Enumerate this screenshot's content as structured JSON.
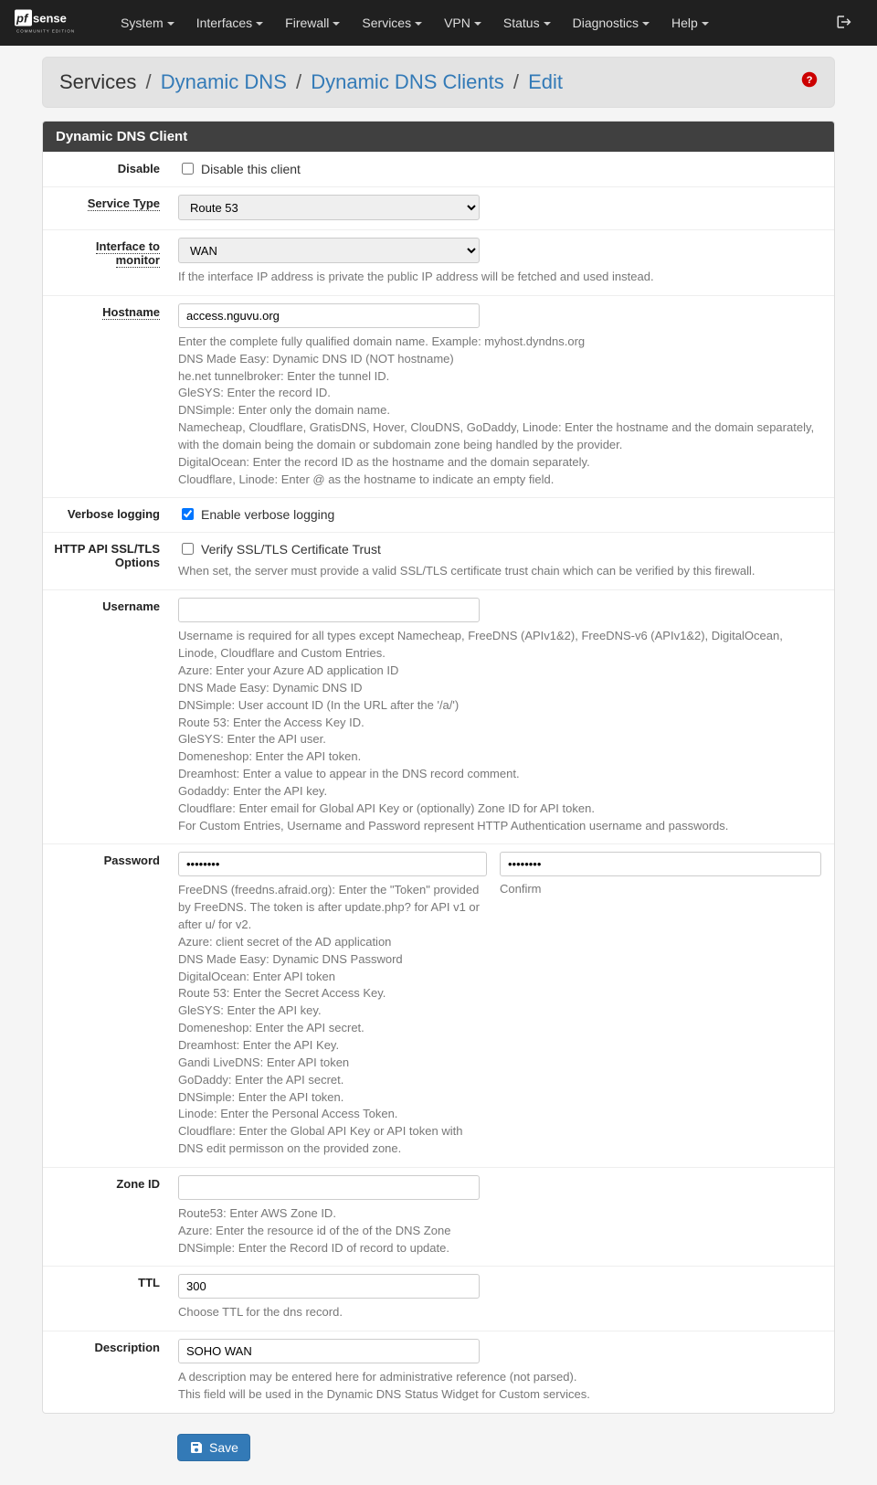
{
  "nav": {
    "items": [
      "System",
      "Interfaces",
      "Firewall",
      "Services",
      "VPN",
      "Status",
      "Diagnostics",
      "Help"
    ]
  },
  "breadcrumb": {
    "a": "Services",
    "b": "Dynamic DNS",
    "c": "Dynamic DNS Clients",
    "d": "Edit"
  },
  "panel_title": "Dynamic DNS Client",
  "labels": {
    "disable": "Disable",
    "service_type": "Service Type",
    "interface": "Interface to monitor",
    "hostname": "Hostname",
    "verbose": "Verbose logging",
    "ssl": "HTTP API SSL/TLS Options",
    "username": "Username",
    "password": "Password",
    "zone": "Zone ID",
    "ttl": "TTL",
    "description": "Description"
  },
  "fields": {
    "disable_label": "Disable this client",
    "disable_checked": false,
    "service_type_value": "Route 53",
    "interface_value": "WAN",
    "hostname_value": "access.nguvu.org",
    "verbose_label": "Enable verbose logging",
    "verbose_checked": true,
    "ssl_label": "Verify SSL/TLS Certificate Trust",
    "ssl_checked": false,
    "username_value": "",
    "password_value": "••••••••",
    "password_confirm_value": "••••••••",
    "confirm_label": "Confirm",
    "zone_value": "",
    "ttl_value": "300",
    "description_value": "SOHO WAN"
  },
  "help": {
    "interface": [
      "If the interface IP address is private the public IP address will be fetched and used instead."
    ],
    "hostname": [
      "Enter the complete fully qualified domain name. Example: myhost.dyndns.org",
      "DNS Made Easy: Dynamic DNS ID (NOT hostname)",
      "he.net tunnelbroker: Enter the tunnel ID.",
      "GleSYS: Enter the record ID.",
      "DNSimple: Enter only the domain name.",
      "Namecheap, Cloudflare, GratisDNS, Hover, ClouDNS, GoDaddy, Linode: Enter the hostname and the domain separately, with the domain being the domain or subdomain zone being handled by the provider.",
      "DigitalOcean: Enter the record ID as the hostname and the domain separately.",
      "Cloudflare, Linode: Enter @ as the hostname to indicate an empty field."
    ],
    "ssl": [
      "When set, the server must provide a valid SSL/TLS certificate trust chain which can be verified by this firewall."
    ],
    "username": [
      "Username is required for all types except Namecheap, FreeDNS (APIv1&2), FreeDNS-v6 (APIv1&2), DigitalOcean, Linode, Cloudflare and Custom Entries.",
      "Azure: Enter your Azure AD application ID",
      "DNS Made Easy: Dynamic DNS ID",
      "DNSimple: User account ID (In the URL after the '/a/')",
      "Route 53: Enter the Access Key ID.",
      "GleSYS: Enter the API user.",
      "Domeneshop: Enter the API token.",
      "Dreamhost: Enter a value to appear in the DNS record comment.",
      "Godaddy: Enter the API key.",
      "Cloudflare: Enter email for Global API Key or (optionally) Zone ID for API token.",
      "For Custom Entries, Username and Password represent HTTP Authentication username and passwords."
    ],
    "password": [
      "FreeDNS (freedns.afraid.org): Enter the \"Token\" provided by FreeDNS. The token is after update.php? for API v1 or after u/ for v2.",
      "Azure: client secret of the AD application",
      "DNS Made Easy: Dynamic DNS Password",
      "DigitalOcean: Enter API token",
      "Route 53: Enter the Secret Access Key.",
      "GleSYS: Enter the API key.",
      "Domeneshop: Enter the API secret.",
      "Dreamhost: Enter the API Key.",
      "Gandi LiveDNS: Enter API token",
      "GoDaddy: Enter the API secret.",
      "DNSimple: Enter the API token.",
      "Linode: Enter the Personal Access Token.",
      "Cloudflare: Enter the Global API Key or API token with DNS edit permisson on the provided zone."
    ],
    "zone": [
      "Route53: Enter AWS Zone ID.",
      "Azure: Enter the resource id of the of the DNS Zone",
      "DNSimple: Enter the Record ID of record to update."
    ],
    "ttl": [
      "Choose TTL for the dns record."
    ],
    "description": [
      "A description may be entered here for administrative reference (not parsed).",
      "This field will be used in the Dynamic DNS Status Widget for Custom services."
    ]
  },
  "save_label": "Save"
}
